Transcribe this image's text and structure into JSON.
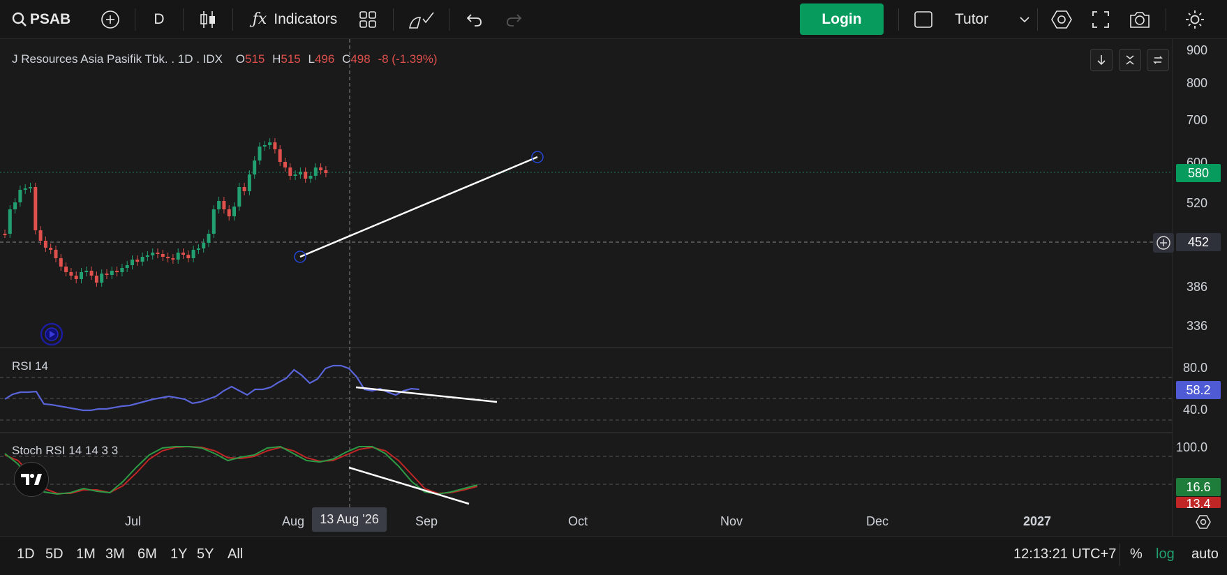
{
  "toolbar": {
    "symbol": "PSAB",
    "interval": "D",
    "indicators_label": "Indicators",
    "login_label": "Login",
    "layout_name": "Tutor"
  },
  "legend": {
    "title": "J Resources Asia Pasifik Tbk. . 1D . IDX",
    "o_label": "O",
    "o_value": "515",
    "h_label": "H",
    "h_value": "515",
    "l_label": "L",
    "l_value": "496",
    "c_label": "C",
    "c_value": "498",
    "change": "-8 (-1.39%)"
  },
  "price_axis": {
    "labels": [
      "900",
      "800",
      "700",
      "600",
      "520",
      "386",
      "336"
    ],
    "current_price": "580",
    "crosshair_price": "452"
  },
  "rsi": {
    "label": "RSI 14",
    "levels": [
      "80.0",
      "40.0"
    ],
    "value": "58.2"
  },
  "stoch": {
    "label": "Stoch RSI 14 14 3 3",
    "level": "100.0",
    "k_value": "16.6",
    "d_value": "13.4"
  },
  "time_axis": {
    "months": [
      "Jul",
      "Aug",
      "Sep",
      "Oct",
      "Nov",
      "Dec",
      "2027"
    ],
    "crosshair_date": "13 Aug '26"
  },
  "bottom": {
    "ranges": [
      "1D",
      "5D",
      "1M",
      "3M",
      "6M",
      "1Y",
      "5Y",
      "All"
    ],
    "clock": "12:13:21 UTC+7",
    "percent": "%",
    "log": "log",
    "auto": "auto"
  },
  "colors": {
    "up": "#22a071",
    "down": "#e0504c",
    "rsi_line": "#5964d8",
    "stoch_k": "#2e9a45",
    "stoch_d": "#c02626",
    "accent": "#089b5e"
  }
}
